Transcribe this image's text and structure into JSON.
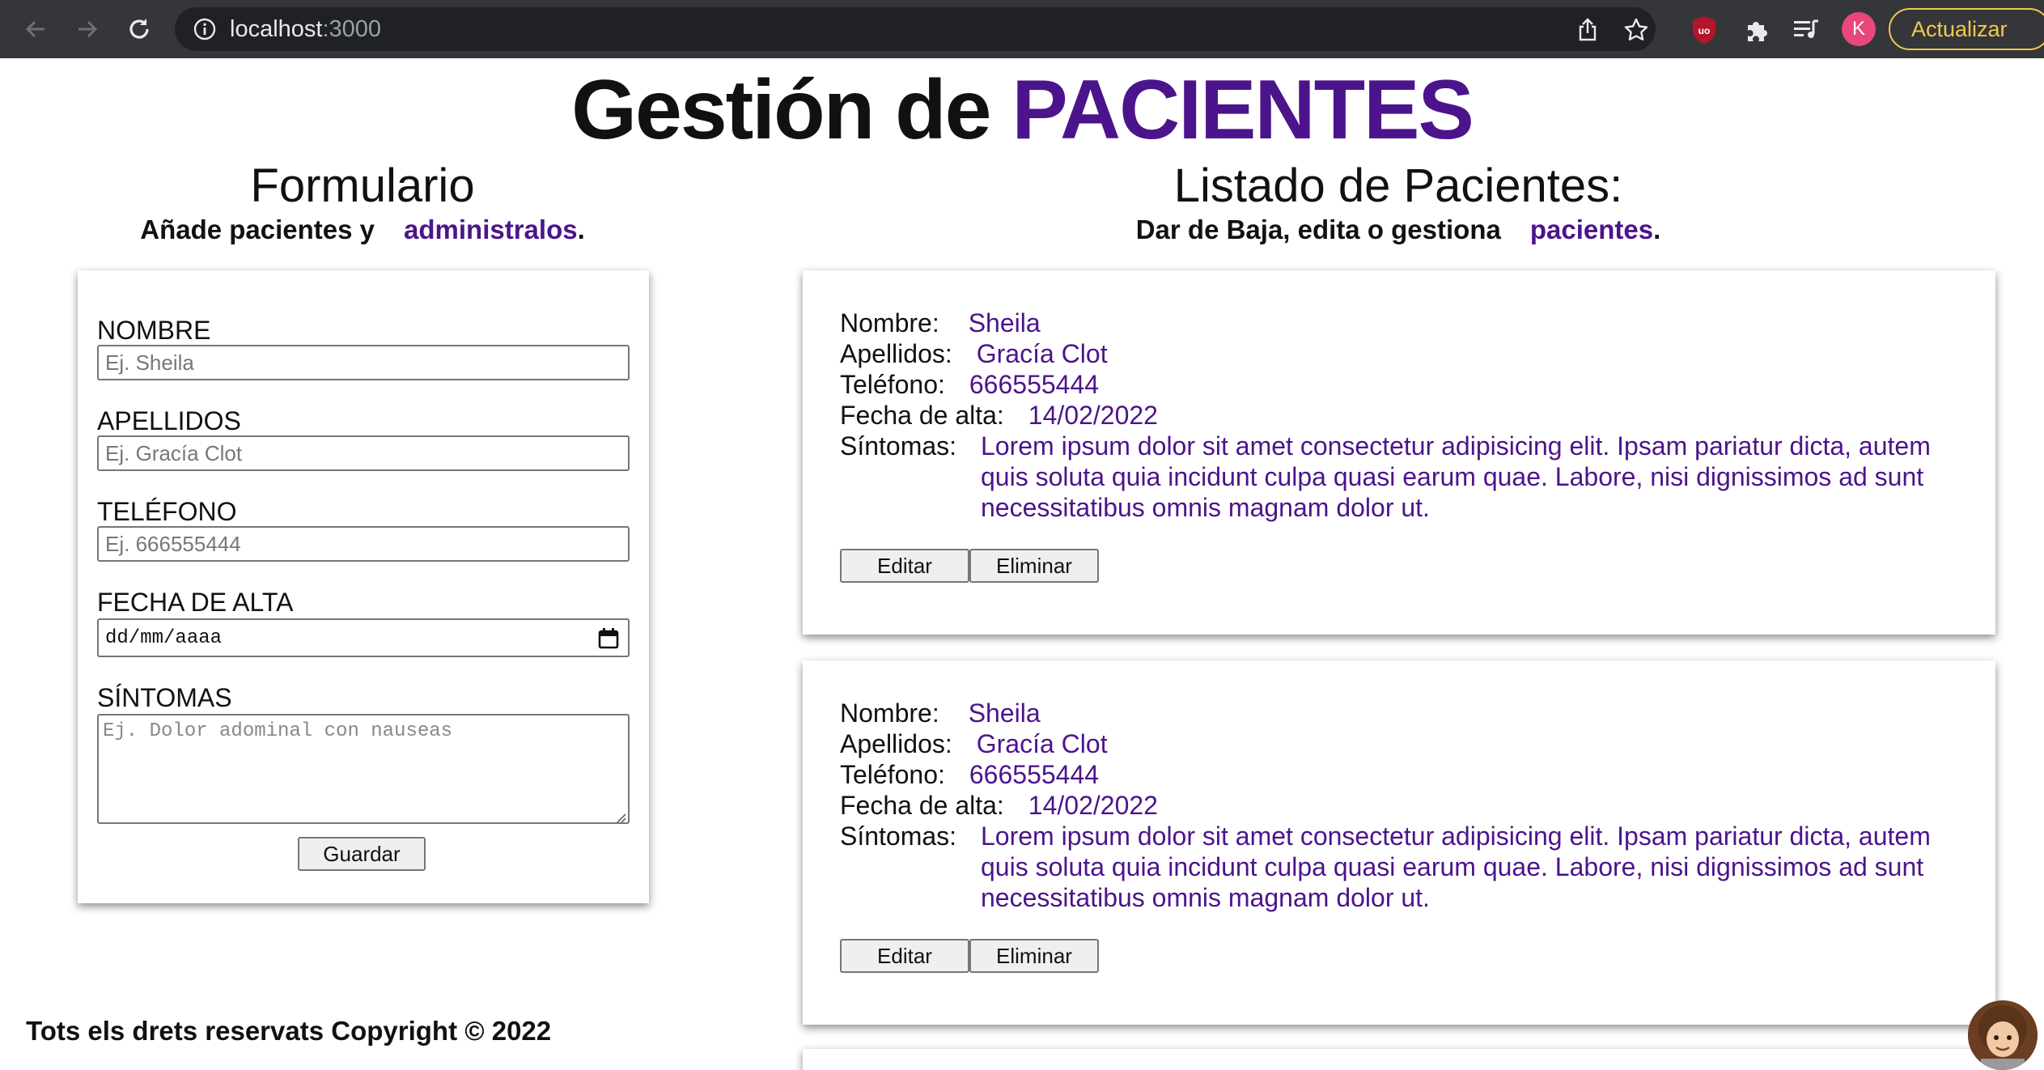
{
  "browser": {
    "url_host": "localhost",
    "url_port": ":3000",
    "profile_initial": "K",
    "update_label": "Actualizar"
  },
  "header": {
    "title_main": "Gestión de",
    "title_accent": "PACIENTES"
  },
  "form_section": {
    "title": "Formulario",
    "subtitle_text": "Añade pacientes y",
    "subtitle_accent": "administralos",
    "subtitle_end": ".",
    "fields": {
      "nombre_label": "NOMBRE",
      "nombre_placeholder": "Ej. Sheila",
      "apellidos_label": "APELLIDOS",
      "apellidos_placeholder": "Ej. Gracía Clot",
      "telefono_label": "TELÉFONO",
      "telefono_placeholder": "Ej. 666555444",
      "fecha_label": "FECHA DE ALTA",
      "fecha_placeholder": "dd/mm/aaaa",
      "sintomas_label": "SÍNTOMAS",
      "sintomas_placeholder": "Ej. Dolor adominal con nauseas"
    },
    "save_label": "Guardar"
  },
  "list_section": {
    "title": "Listado de Pacientes:",
    "subtitle_text": "Dar de Baja, edita o gestiona",
    "subtitle_accent": "pacientes",
    "subtitle_end": ".",
    "labels": {
      "nombre": "Nombre:",
      "apellidos": "Apellidos:",
      "telefono": "Teléfono:",
      "fecha": "Fecha de alta:",
      "sintomas": "Síntomas:"
    },
    "edit_label": "Editar",
    "delete_label": "Eliminar",
    "patients": [
      {
        "nombre": "Sheila",
        "apellidos": "Gracía Clot",
        "telefono": "666555444",
        "fecha": "14/02/2022",
        "sintomas": "Lorem ipsum dolor sit amet consectetur adipisicing elit. Ipsam pariatur dicta, autem quis soluta quia incidunt culpa quasi earum quae. Labore, nisi dignissimos ad sunt necessitatibus omnis magnam dolor ut."
      },
      {
        "nombre": "Sheila",
        "apellidos": "Gracía Clot",
        "telefono": "666555444",
        "fecha": "14/02/2022",
        "sintomas": "Lorem ipsum dolor sit amet consectetur adipisicing elit. Ipsam pariatur dicta, autem quis soluta quia incidunt culpa quasi earum quae. Labore, nisi dignissimos ad sunt necessitatibus omnis magnam dolor ut."
      }
    ]
  },
  "footer": {
    "text": "Tots els drets reservats Copyright © 2022"
  },
  "colors": {
    "accent": "#4c148c",
    "chrome_bg": "#35363a",
    "omnibox_bg": "#202124",
    "update_yellow": "#f2c94c",
    "profile_pink": "#e8477a"
  },
  "icons": [
    "back-arrow-icon",
    "forward-arrow-icon",
    "reload-icon",
    "info-icon",
    "share-icon",
    "star-icon",
    "ublock-icon",
    "extensions-puzzle-icon",
    "media-playlist-icon",
    "calendar-icon",
    "memoji-avatar-icon"
  ]
}
